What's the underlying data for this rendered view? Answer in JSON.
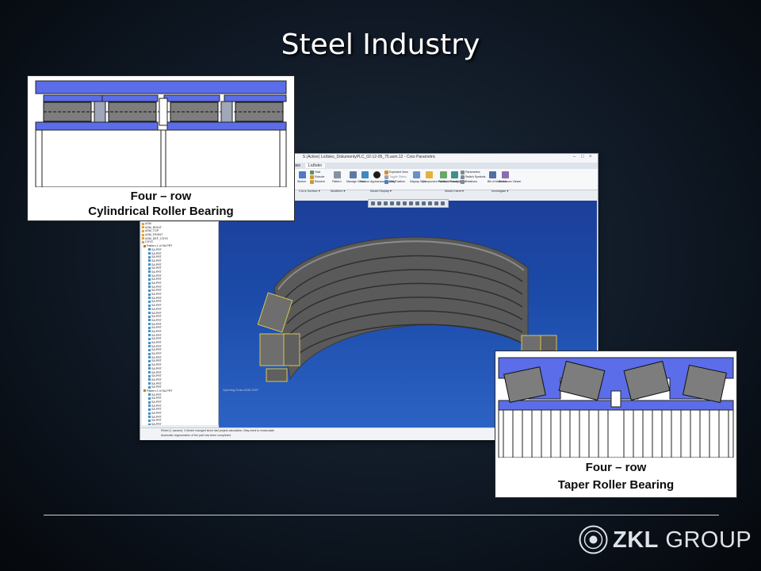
{
  "slide": {
    "title": "Steel Industry"
  },
  "cylindrical_panel": {
    "caption_line1": "Four – row",
    "caption_line2": "Cylindrical Roller Bearing"
  },
  "taper_panel": {
    "caption_line1": "Four – row",
    "caption_line2": "Taper Roller Bearing"
  },
  "cad": {
    "window_title": "S (Active) Ložisko_DokumentyPLC_02-12-05_75.asm.12 - Creo Parametric",
    "tabs": [
      "ews",
      "Ložisko"
    ],
    "ribbon_labels": [
      "Sketch",
      "Hole",
      "Extrude",
      "Revolve",
      "Pattern",
      "Manage Views",
      "Section",
      "Appearance Gallery",
      "Exploded View",
      "Toggle Status",
      "Edit Position",
      "Display Style",
      "Component Interface",
      "Publish Geometry",
      "Family Table",
      "Parameters",
      "Switch Symbols",
      "Relations",
      "Bill of Materials",
      "Reference Viewer"
    ],
    "group_labels": [
      "Cut & Surface ▾",
      "Modifiers ▾",
      "Model Display ▾",
      "Model Intent ▾",
      "Investigate ▾"
    ],
    "tree_header": [
      "ASM",
      "ASM_RIGHT",
      "ASM_TOP",
      "ASM_FRONT",
      "ASM_DEF_CSYS",
      "CSYS"
    ],
    "tree_items": [
      "Pattern 1 of SA.PRT",
      "SA.PRT",
      "SA.PRT",
      "SA.PRT",
      "SA.PRT",
      "SA.PRT",
      "SA.PRT",
      "SA.PRT",
      "SA.PRT",
      "SA.PRT",
      "SA.PRT",
      "SA.PRT",
      "SA.PRT",
      "SA.PRT",
      "SA.PRT",
      "SA.PRT",
      "SA.PRT",
      "SA.PRT",
      "SA.PRT",
      "SA.PRT",
      "SA.PRT",
      "SA.PRT",
      "SA.PRT",
      "SA.PRT",
      "SA.PRT",
      "SA.PRT",
      "SA.PRT",
      "SA.PRT",
      "SA.PRT",
      "SA.PRT",
      "SA.PRT",
      "SA.PRT",
      "SA.PRT",
      "SA.PRT",
      "SA.PRT",
      "SA.PRT",
      "SA.PRT",
      "SA.PRT",
      "SA.PRT",
      "Pattern 2 of SA.PRT",
      "SA.PRT",
      "SA.PRT",
      "SA.PRT",
      "SA.PRT",
      "SA.PRT",
      "SA.PRT",
      "SA.PRT",
      "SA.PRT",
      "SA.PRT"
    ],
    "status_line1": "Rebel (1 causes): 4 Model changed since last project calculation. May need to recalculate.",
    "status_line2": "Automatic regeneration of the part has been completed.",
    "coord_readout": "Opening Draw ASM 2007"
  },
  "logo": {
    "brand": "ZKL",
    "suffix": " GROUP"
  },
  "colors": {
    "bearing_blue": "#5b6de8",
    "graphics_blue": "#1d3f9a",
    "roller_gray": "#7d7d7d"
  }
}
